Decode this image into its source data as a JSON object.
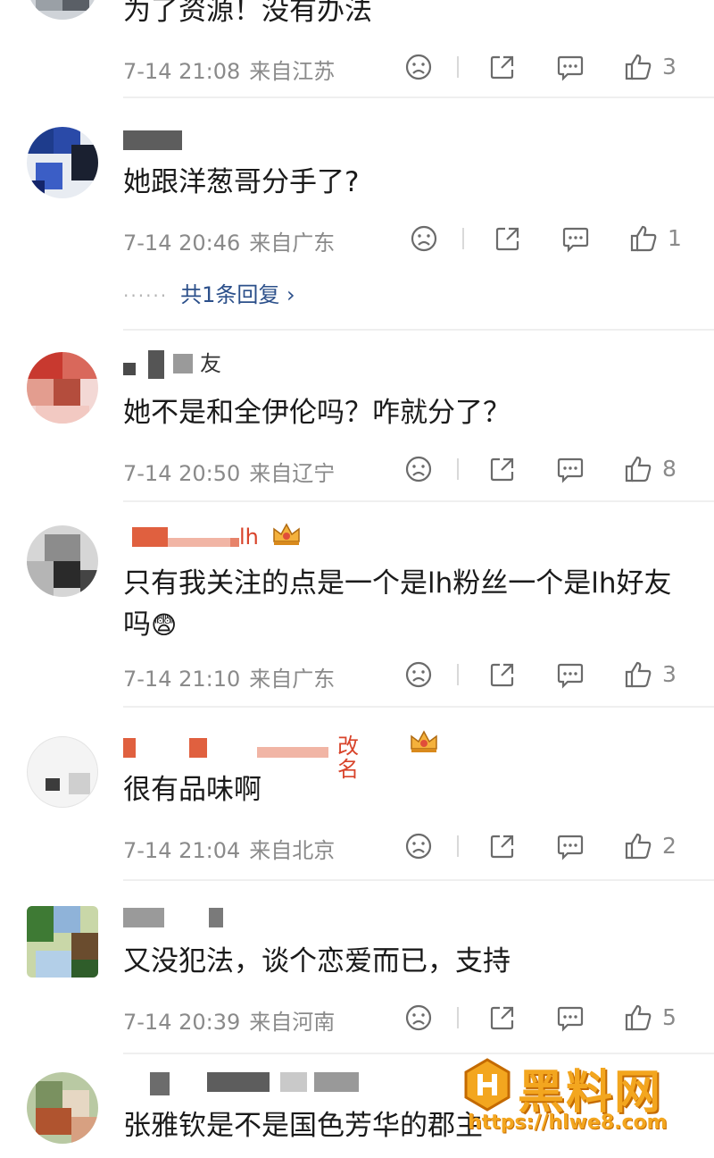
{
  "comments": [
    {
      "username": "",
      "text": "为了资源！没有办法",
      "time": "7-14 21:08",
      "location": "来自江苏",
      "likes": "3"
    },
    {
      "username": "",
      "text": "她跟洋葱哥分手了?",
      "time": "7-14 20:46",
      "location": "来自广东",
      "likes": "1",
      "replies": "共1条回复 ›"
    },
    {
      "username_suffix": "友",
      "text": "她不是和全伊伦吗？咋就分了？",
      "time": "7-14 20:50",
      "location": "来自辽宁",
      "likes": "8"
    },
    {
      "username_suffix": "lh",
      "text": "只有我关注的点是一个是lh粉丝一个是lh好友吗",
      "emoji": "😨",
      "time": "7-14 21:10",
      "location": "来自广东",
      "likes": "3"
    },
    {
      "username_suffix": "改名",
      "text": "很有品味啊",
      "time": "7-14 21:04",
      "location": "来自北京",
      "likes": "2"
    },
    {
      "username": "",
      "text": "又没犯法，谈个恋爱而已，支持",
      "time": "7-14 20:39",
      "location": "来自河南",
      "likes": "5"
    },
    {
      "username": "",
      "text": "张雅钦是不是国色芳华的郡主"
    }
  ],
  "watermark": {
    "title": "黑料网",
    "url": "https://hlwe8.com"
  },
  "colors": {
    "accent_username": "#d8432a",
    "meta_gray": "#8a8a8a",
    "reply_blue": "#2b4f8a",
    "watermark": "#f3a61f"
  },
  "icons": [
    "sad-face-icon",
    "share-icon",
    "comment-icon",
    "thumbs-up-icon",
    "crown-badge-icon"
  ]
}
